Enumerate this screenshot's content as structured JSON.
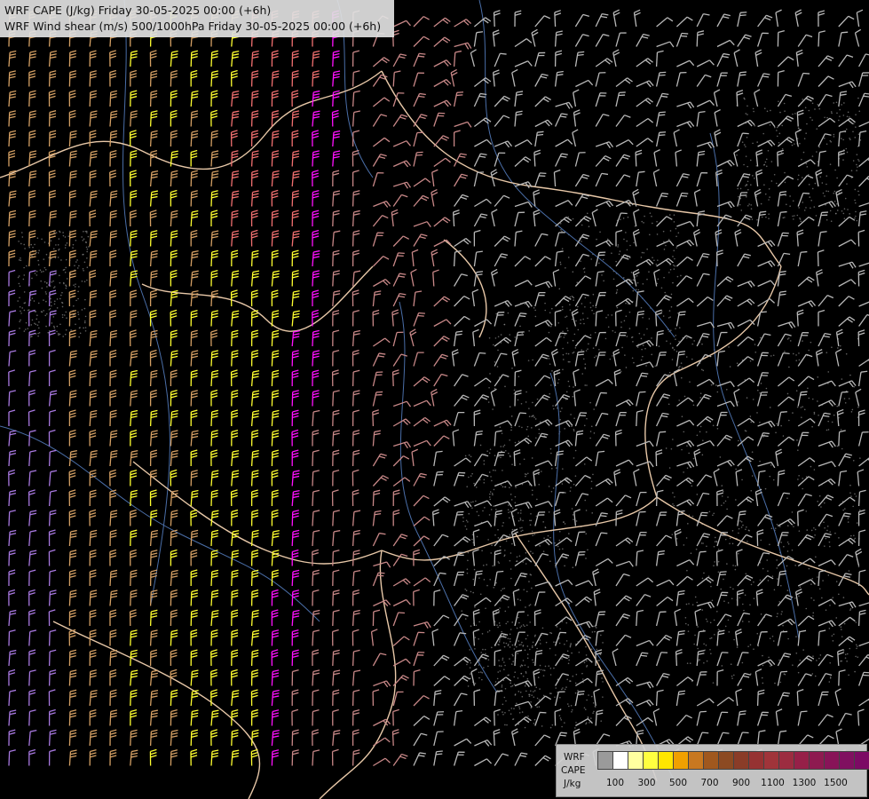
{
  "title": {
    "line1": "WRF CAPE (J/kg) Friday 30-05-2025 00:00 (+6h)",
    "line2": "WRF Wind shear (m/s) 500/1000hPa Friday 30-05-2025 00:00 (+6h)"
  },
  "legend": {
    "label1": "WRF",
    "label2": "CAPE",
    "label3": "J/kg",
    "swatch_colors": [
      "#9a9a9a",
      "#ffffff",
      "#ffffa0",
      "#ffff40",
      "#ffe600",
      "#f0a000",
      "#c87820",
      "#a0581e",
      "#8c4a22",
      "#8a3c28",
      "#963232",
      "#a0343a",
      "#9c2c40",
      "#962048",
      "#8e1a50",
      "#881458",
      "#801060",
      "#7c0a64",
      "#80086a"
    ],
    "ticks": [
      "100",
      "300",
      "500",
      "700",
      "900",
      "1100",
      "1300",
      "1500"
    ]
  },
  "colors": {
    "background": "#000000",
    "borders": "#e8c8a8",
    "rivers": "#4a6ea8",
    "relief": "#8a8a8a",
    "barb_gray": "#b8b8b8",
    "barb_pink": "#c88888",
    "barb_tan": "#d4a064",
    "barb_yellow": "#ffff30",
    "barb_salmon": "#f07070",
    "barb_magenta": "#ff10ff",
    "barb_purple": "#a878e0"
  }
}
